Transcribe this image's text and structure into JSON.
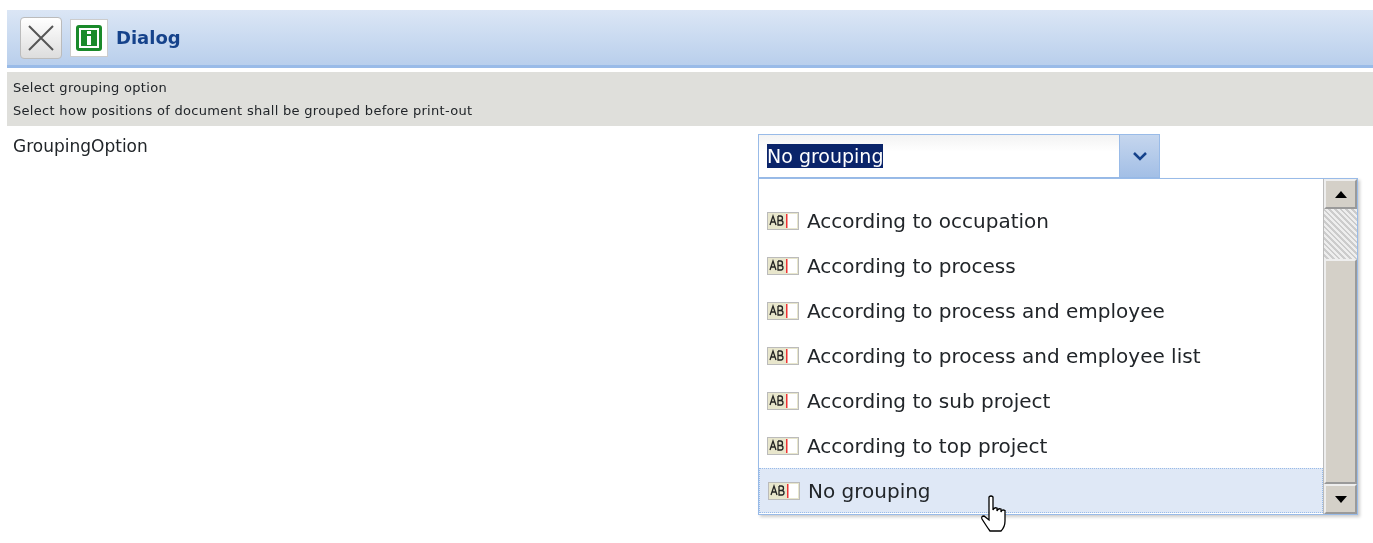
{
  "window": {
    "title": "Dialog"
  },
  "info": {
    "heading": "Select grouping option",
    "description": "Select how positions of document shall be grouped before print-out"
  },
  "field": {
    "label": "GroupingOption",
    "value": "No grouping",
    "expanded": true
  },
  "options": [
    {
      "label": "According to occupation",
      "selected": false
    },
    {
      "label": "According to process",
      "selected": false
    },
    {
      "label": "According to process and employee",
      "selected": false
    },
    {
      "label": "According to process and employee list",
      "selected": false
    },
    {
      "label": "According to sub project",
      "selected": false
    },
    {
      "label": "According to top project",
      "selected": false
    },
    {
      "label": "No grouping",
      "selected": true
    }
  ]
}
